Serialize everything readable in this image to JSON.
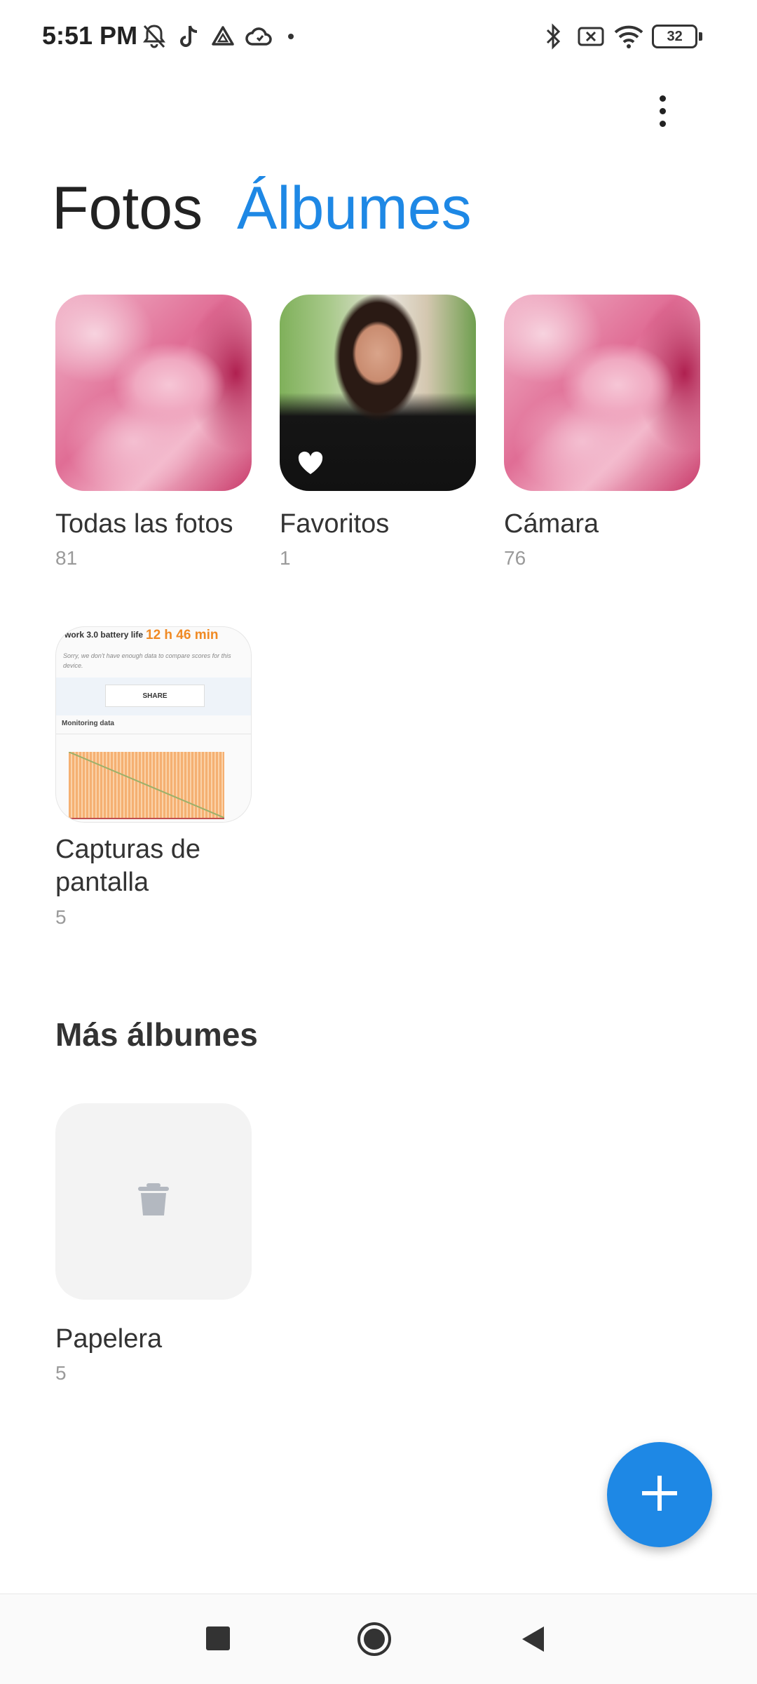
{
  "status_bar": {
    "time": "5:51 PM",
    "battery": "32",
    "icons": [
      "bell-off-icon",
      "tiktok-icon",
      "drive-icon",
      "cloud-icon",
      "dot-icon",
      "bluetooth-icon",
      "sim-x-icon",
      "wifi-icon",
      "battery-icon"
    ]
  },
  "header": {
    "menu_icon": "more-vert-icon"
  },
  "tabs": [
    {
      "label": "Fotos",
      "active": false
    },
    {
      "label": "Álbumes",
      "active": true
    }
  ],
  "albums": [
    {
      "name": "Todas las fotos",
      "count": "81",
      "thumb": "rose-photo"
    },
    {
      "name": "Favoritos",
      "count": "1",
      "thumb": "portrait-photo"
    },
    {
      "name": "Cámara",
      "count": "76",
      "thumb": "rose-photo"
    },
    {
      "name": "Capturas de pantalla",
      "count": "5",
      "thumb": "screenshot"
    }
  ],
  "screenshot_thumb": {
    "title": "work 3.0 battery life",
    "value": "12 h 46 min",
    "note": "Sorry, we don't have enough data to compare scores for this device.",
    "share": "SHARE",
    "section": "Monitoring data"
  },
  "more_albums": {
    "heading": "Más álbumes",
    "items": [
      {
        "name": "Papelera",
        "count": "5",
        "icon": "trash-icon"
      }
    ]
  },
  "fab": {
    "icon": "plus-icon"
  },
  "nav_bar": {
    "icons": [
      "square-recent-icon",
      "circle-home-icon",
      "triangle-back-icon"
    ]
  },
  "colors": {
    "accent": "#1e88e5",
    "text": "#222222",
    "muted": "#9a9a9a"
  }
}
